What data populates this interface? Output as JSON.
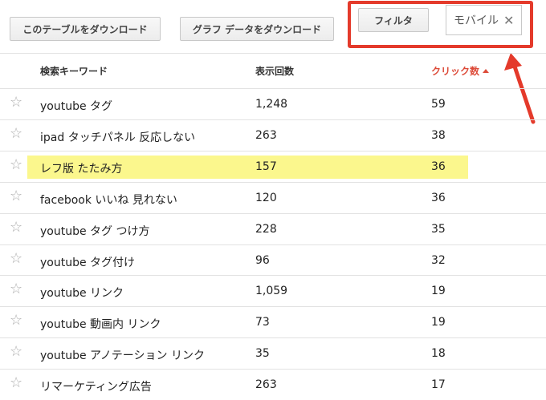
{
  "toolbar": {
    "download_table_label": "このテーブルをダウンロード",
    "download_graph_label": "グラフ データをダウンロード",
    "filter_label": "フィルタ",
    "filter_chip": {
      "value": "モバイル",
      "close_glyph": "✕"
    }
  },
  "table": {
    "headers": {
      "keyword": "検索キーワード",
      "impressions": "表示回数",
      "clicks": "クリック数"
    },
    "sort": {
      "column": "clicks",
      "direction": "desc"
    },
    "rows": [
      {
        "keyword": "youtube タグ",
        "impressions": "1,248",
        "clicks": "59",
        "starred": false,
        "highlighted": false
      },
      {
        "keyword": "ipad タッチパネル 反応しない",
        "impressions": "263",
        "clicks": "38",
        "starred": false,
        "highlighted": false
      },
      {
        "keyword": "レフ版 たたみ方",
        "impressions": "157",
        "clicks": "36",
        "starred": false,
        "highlighted": true
      },
      {
        "keyword": "facebook いいね 見れない",
        "impressions": "120",
        "clicks": "36",
        "starred": false,
        "highlighted": false
      },
      {
        "keyword": "youtube タグ つけ方",
        "impressions": "228",
        "clicks": "35",
        "starred": false,
        "highlighted": false
      },
      {
        "keyword": "youtube タグ付け",
        "impressions": "96",
        "clicks": "32",
        "starred": false,
        "highlighted": false
      },
      {
        "keyword": "youtube リンク",
        "impressions": "1,059",
        "clicks": "19",
        "starred": false,
        "highlighted": false
      },
      {
        "keyword": "youtube 動画内 リンク",
        "impressions": "73",
        "clicks": "19",
        "starred": false,
        "highlighted": false
      },
      {
        "keyword": "youtube アノテーション リンク",
        "impressions": "35",
        "clicks": "18",
        "starred": false,
        "highlighted": false
      },
      {
        "keyword": "リマーケティング広告",
        "impressions": "263",
        "clicks": "17",
        "starred": false,
        "highlighted": false
      }
    ]
  },
  "icons": {
    "star": "star-outline-icon",
    "sort": "sort-arrow-up-icon",
    "close": "close-icon"
  },
  "colors": {
    "annotation_red": "#e43a2b",
    "sorted_header": "#dd4b39",
    "row_highlight": "#fbf78d",
    "star_gray": "#b0b0b0"
  }
}
